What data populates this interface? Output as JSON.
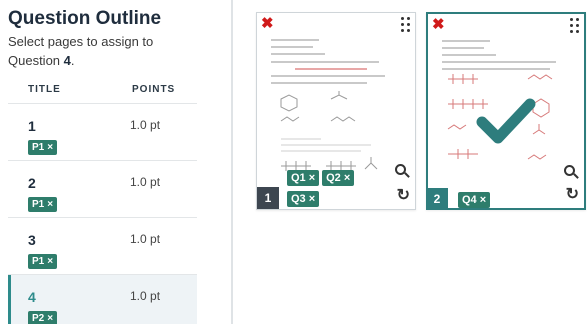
{
  "outline": {
    "title": "Question Outline",
    "subtitle_prefix": "Select pages to assign to",
    "subtitle_question_word": "Question",
    "subtitle_question_number": "4",
    "subtitle_suffix": ".",
    "col_title": "TITLE",
    "col_points": "POINTS",
    "questions": [
      {
        "number": "1",
        "points": "1.0 pt",
        "tag": "P1",
        "active": false
      },
      {
        "number": "2",
        "points": "1.0 pt",
        "tag": "P1",
        "active": false
      },
      {
        "number": "3",
        "points": "1.0 pt",
        "tag": "P1",
        "active": false
      },
      {
        "number": "4",
        "points": "1.0 pt",
        "tag": "P2",
        "active": true
      }
    ],
    "tag_remove_glyph": "×"
  },
  "pages": [
    {
      "number": "1",
      "selected": false,
      "tags": [
        "Q1",
        "Q2",
        "Q3"
      ],
      "icons": [
        "delete-icon",
        "kebab-icon",
        "zoom-icon",
        "rotate-icon"
      ]
    },
    {
      "number": "2",
      "selected": true,
      "tags": [
        "Q4"
      ],
      "icons": [
        "delete-icon",
        "kebab-icon",
        "zoom-icon",
        "rotate-icon",
        "check-icon"
      ]
    }
  ],
  "glyphs": {
    "delete": "✖",
    "remove": "×",
    "rotate": "↻"
  },
  "colors": {
    "accent": "#2e7d7d",
    "tag": "#2e7d6b",
    "delete": "#d01a1a",
    "page_num_bg": "#3d4650"
  }
}
